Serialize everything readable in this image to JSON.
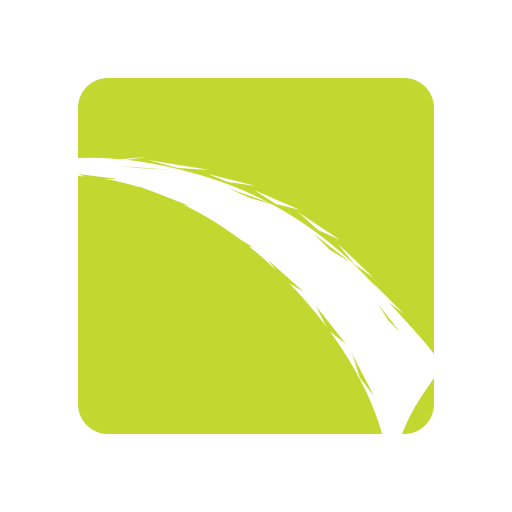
{
  "icon": {
    "name": "lime-square-swoosh-icon",
    "colors": {
      "background": "#ffffff",
      "tile": "#c2d830",
      "stroke": "#ffffff"
    }
  }
}
